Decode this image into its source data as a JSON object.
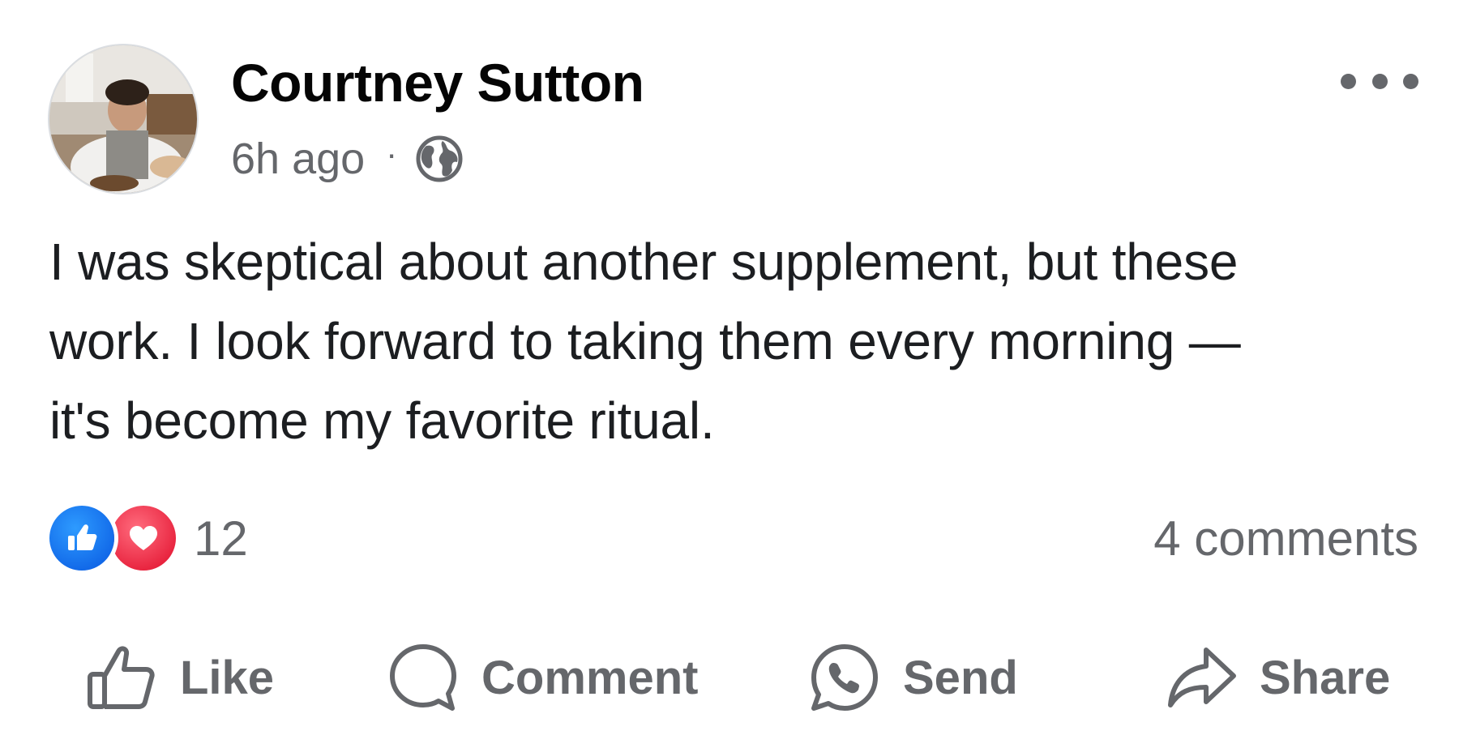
{
  "post": {
    "author": {
      "name": "Courtney Sutton",
      "avatar_icon": "profile-photo"
    },
    "timestamp": "6h ago",
    "separator": "·",
    "privacy_icon": "globe-icon",
    "more_icon": "more-horizontal-icon",
    "text_lines": [
      "I was skeptical about another supplement, but these",
      "work. I look forward to taking them every morning —",
      "it's become my favorite ritual."
    ],
    "reactions": {
      "icons": [
        "like-reaction-icon",
        "love-reaction-icon"
      ],
      "count": "12"
    },
    "comments_count": "4 comments",
    "actions": {
      "like": "Like",
      "comment": "Comment",
      "send": "Send",
      "share": "Share"
    }
  },
  "colors": {
    "text_primary": "#050505",
    "text_secondary": "#65676b",
    "like_blue": "#1877f2",
    "love_red": "#f33e58"
  }
}
